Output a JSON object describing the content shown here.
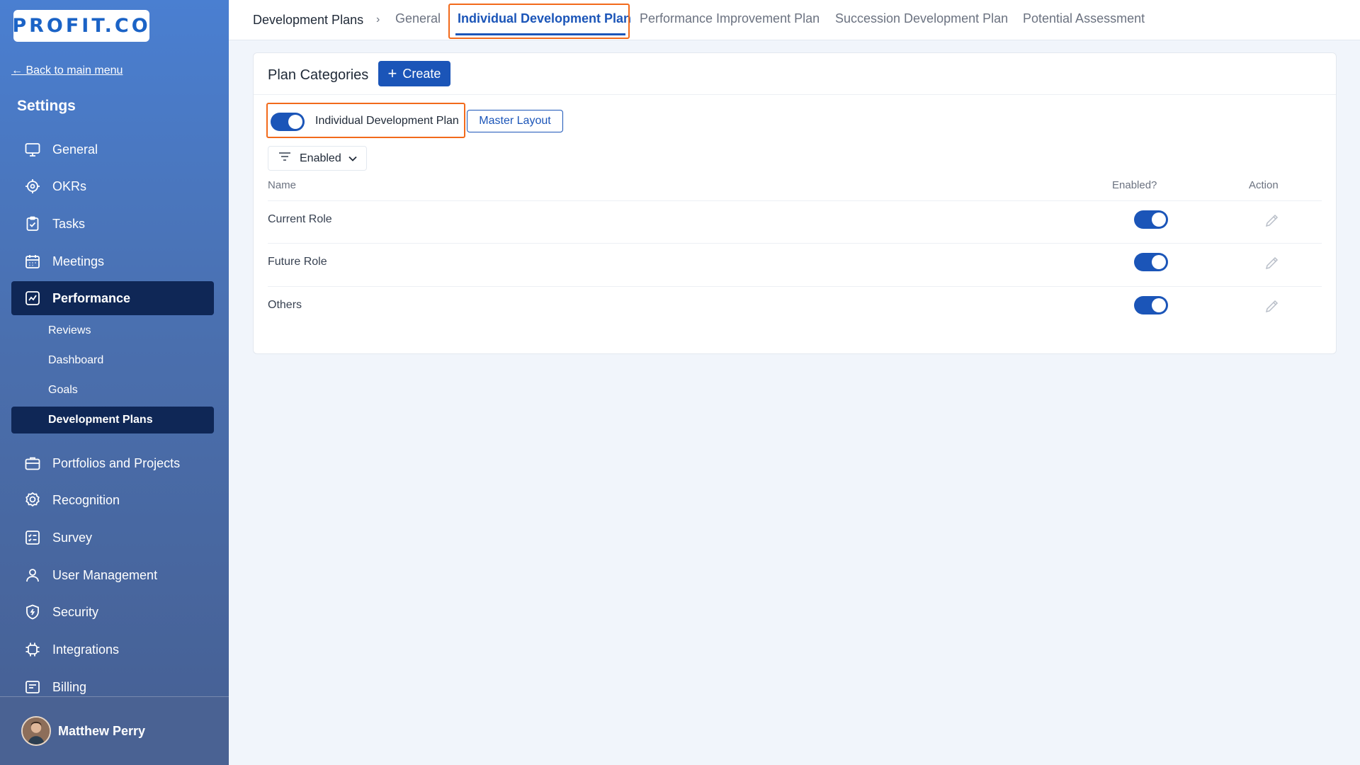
{
  "brand": {
    "logo_text": "PROFIT.CO",
    "accent": "#1b55b8",
    "highlight": "#f26a1b"
  },
  "sidebar": {
    "back_label": "← Back to main menu",
    "title": "Settings",
    "items": [
      {
        "label": "General",
        "icon": "monitor-icon"
      },
      {
        "label": "OKRs",
        "icon": "target-icon"
      },
      {
        "label": "Tasks",
        "icon": "clipboard-check-icon"
      },
      {
        "label": "Meetings",
        "icon": "calendar-icon"
      },
      {
        "label": "Performance",
        "icon": "chart-line-icon",
        "active": true
      },
      {
        "label": "Portfolios and Projects",
        "icon": "briefcase-icon"
      },
      {
        "label": "Recognition",
        "icon": "badge-icon"
      },
      {
        "label": "Survey",
        "icon": "survey-list-icon"
      },
      {
        "label": "User Management",
        "icon": "user-icon"
      },
      {
        "label": "Security",
        "icon": "shield-icon"
      },
      {
        "label": "Integrations",
        "icon": "chip-icon"
      },
      {
        "label": "Billing",
        "icon": "billing-icon"
      }
    ],
    "sub_items": [
      {
        "label": "Reviews"
      },
      {
        "label": "Dashboard"
      },
      {
        "label": "Goals"
      },
      {
        "label": "Development Plans",
        "active": true
      }
    ],
    "user": {
      "name": "Matthew Perry"
    }
  },
  "topbar": {
    "breadcrumb": "Development Plans",
    "separator": "›",
    "tabs": [
      {
        "label": "General"
      },
      {
        "label": "Individual Development Plan",
        "active": true
      },
      {
        "label": "Performance Improvement Plan"
      },
      {
        "label": "Succession Development Plan"
      },
      {
        "label": "Potential Assessment"
      }
    ]
  },
  "card": {
    "title": "Plan Categories",
    "create_label": "Create",
    "plan_toggle_label": "Individual Development Plan",
    "plan_enabled": true,
    "master_layout_label": "Master Layout",
    "filter_label": "Enabled",
    "columns": {
      "name": "Name",
      "enabled": "Enabled?",
      "action": "Action"
    },
    "rows": [
      {
        "name": "Current Role",
        "enabled": true
      },
      {
        "name": "Future Role",
        "enabled": true
      },
      {
        "name": "Others",
        "enabled": true
      }
    ]
  }
}
